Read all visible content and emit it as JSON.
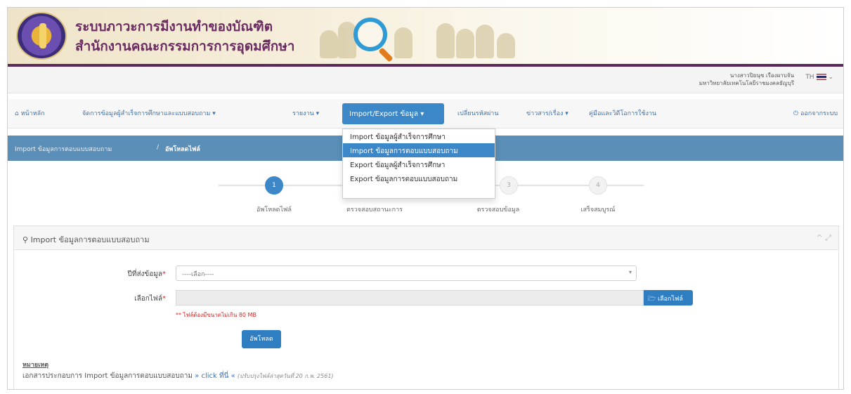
{
  "banner": {
    "title": "ระบบภาวะการมีงานทำของบัณฑิต",
    "subtitle": "สำนักงานคณะกรรมการการอุดมศึกษา"
  },
  "user": {
    "name_line1": "นางสาวปิยนุช เรืองผาบจัน",
    "name_line2": "มหาวิทยาลัยเทคโนโลยีราชมงคลธัญบุรี",
    "language": "TH"
  },
  "nav": {
    "home": "หน้าหลัก",
    "manage": "จัดการข้อมูลผู้สำเร็จการศึกษาและแบบสอบถาม",
    "reports": "รายงาน",
    "import_export": "Import/Export ข้อมูล",
    "change_password": "เปลี่ยนรหัสผ่าน",
    "news": "ข่าวสาร/เรื่อง",
    "manual": "คู่มือและวิดีโอการใช้งาน",
    "logout": "ออกจากระบบ"
  },
  "dropdown": {
    "items": [
      "Import ข้อมูลผู้สำเร็จการศึกษา",
      "Import ข้อมูลการตอบแบบสอบถาม",
      "Export ข้อมูลผู้สำเร็จการศึกษา",
      "Export ข้อมูลการตอบแบบสอบถาม"
    ],
    "selected_index": 1
  },
  "breadcrumb": {
    "parent": "Import ข้อมูลการตอบแบบสอบถาม",
    "separator": "/",
    "current": "อัพโหลดไฟล์"
  },
  "steps": [
    {
      "number": "1",
      "label": "อัพโหลดไฟล์"
    },
    {
      "number": "2",
      "label": "ตรวจสอบสถานะการ"
    },
    {
      "number": "3",
      "label": "ตรวจสอบข้อมูล"
    },
    {
      "number": "4",
      "label": "เสร็จสมบูรณ์"
    }
  ],
  "panel": {
    "title": "Import ข้อมูลการตอบแบบสอบถาม",
    "tools": "^ ⤢"
  },
  "form": {
    "year_label": "ปีที่ส่งข้อมูล",
    "year_placeholder": "----เลือก----",
    "file_label": "เลือกไฟล์",
    "file_button": "เลือกไฟล์",
    "hint": "** ไฟล์ต้องมีขนาดไม่เกิน 80 MB",
    "upload_button": "อัพโหลด",
    "required_mark": "*"
  },
  "note": {
    "title": "หมายเหตุ",
    "text": "เอกสารประกอบการ Import ข้อมูลการตอบแบบสอบถาม",
    "link": "» click ที่นี่ «",
    "updated": "(ปรับปรุงไฟล์ล่าสุดวันที่ 20 ก.พ. 2561)"
  },
  "colors": {
    "brand_purple": "#6b2c63",
    "accent_blue": "#3b87c8",
    "breadcrumb_bar": "#5b8fb8"
  }
}
